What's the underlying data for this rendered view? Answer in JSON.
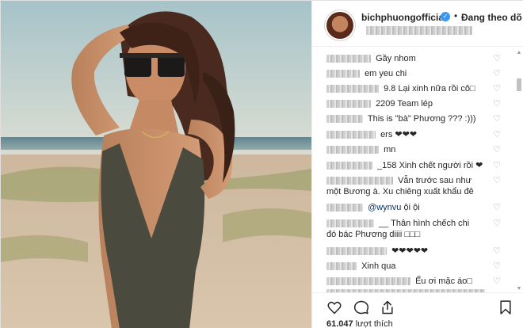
{
  "profile": {
    "username": "bichphuongofficial",
    "follow_status": "Đang theo dõ",
    "separator": "•"
  },
  "comments": [
    {
      "text": "Gầy nhom"
    },
    {
      "text": "em yeu chi"
    },
    {
      "text": "9.8 Lại xinh nữa rồi cô□"
    },
    {
      "text": "2209 Team lép"
    },
    {
      "text": "This is \"bà\" Phương ??? :)))"
    },
    {
      "text": "ers ❤❤❤"
    },
    {
      "text": "mn"
    },
    {
      "text": "_158 Xinh chết người rồi ❤"
    },
    {
      "text": "Vẫn trước sau như",
      "text2": "một Bương à. Xu chiêng xuất khẩu đê"
    },
    {
      "mention": "@wynvu",
      "text": "ội ội"
    },
    {
      "text": "__ Thân hình chếch chi",
      "text2": "đó bác Phương diiii □□□"
    },
    {
      "text": "❤❤❤❤❤"
    },
    {
      "text": "Xinh qua"
    },
    {
      "text": "Ếu ơi mặc áo□"
    }
  ],
  "likes": {
    "count": "61.047",
    "label": "lượt thích"
  },
  "icons": {
    "like": "heart-outline-icon",
    "comment": "comment-bubble-icon",
    "share": "share-upload-icon",
    "save": "bookmark-icon"
  },
  "colors": {
    "verified": "#3897f0",
    "text": "#262626",
    "mention": "#003569"
  }
}
